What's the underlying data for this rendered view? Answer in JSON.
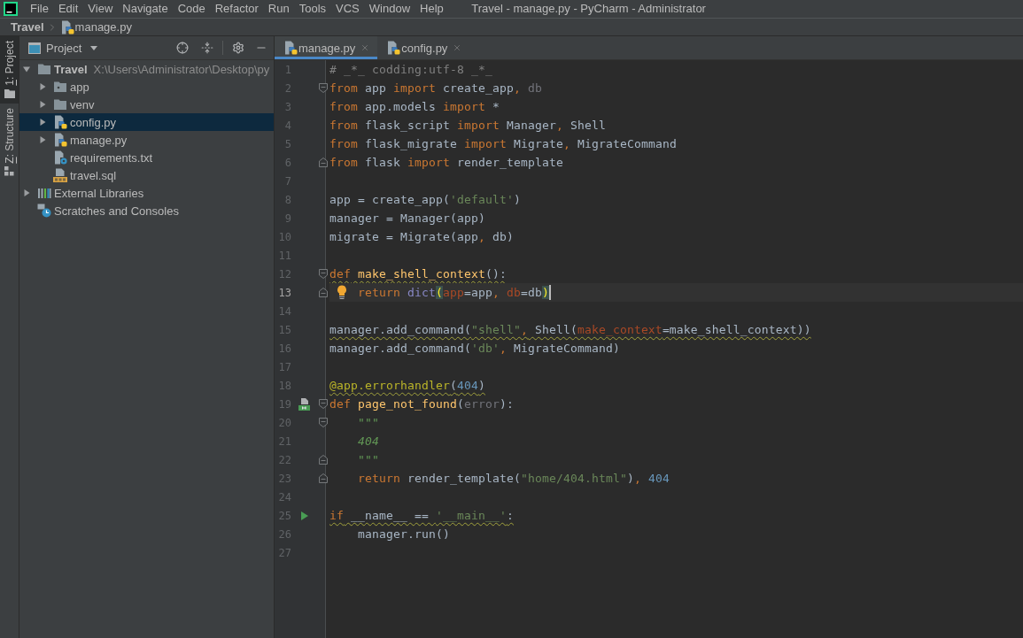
{
  "menu_bar": {
    "items": [
      "File",
      "Edit",
      "View",
      "Navigate",
      "Code",
      "Refactor",
      "Run",
      "Tools",
      "VCS",
      "Window",
      "Help"
    ],
    "title": "Travel - manage.py - PyCharm - Administrator"
  },
  "breadcrumb": [
    {
      "label": "Travel",
      "kind": "project"
    },
    {
      "label": "manage.py",
      "kind": "python"
    }
  ],
  "tool_stripe": [
    {
      "label": "1: Project",
      "kind": "project",
      "selected": true
    },
    {
      "label": "Z: Structure",
      "kind": "structure",
      "selected": false
    }
  ],
  "project_panel": {
    "title": "Project",
    "tree": [
      {
        "label": "Travel",
        "path": "X:\\Users\\Administrator\\Desktop\\py",
        "kind": "root",
        "expanded": true,
        "selected": false,
        "children": [
          {
            "label": "app",
            "kind": "package",
            "expanded": false,
            "selected": false
          },
          {
            "label": "venv",
            "kind": "folder",
            "expanded": false,
            "selected": false
          },
          {
            "label": "config.py",
            "kind": "python",
            "expanded": false,
            "selected": true
          },
          {
            "label": "manage.py",
            "kind": "python",
            "expanded": false,
            "selected": false
          },
          {
            "label": "requirements.txt",
            "kind": "requirements",
            "selected": false
          },
          {
            "label": "travel.sql",
            "kind": "sql",
            "selected": false
          }
        ]
      },
      {
        "label": "External Libraries",
        "kind": "libraries",
        "expanded": false,
        "selected": false
      },
      {
        "label": "Scratches and Consoles",
        "kind": "scratches",
        "selected": false
      }
    ]
  },
  "editor": {
    "tabs": [
      {
        "label": "manage.py",
        "selected": true
      },
      {
        "label": "config.py",
        "selected": false
      }
    ],
    "lines": [
      {
        "number": "1",
        "current": false,
        "warning": false,
        "tokens": [
          {
            "text": "# _*_ codding:utf-8 _*_",
            "kind": "comment"
          }
        ]
      },
      {
        "number": "2",
        "current": false,
        "warning": false,
        "fold_open": true,
        "tokens": [
          {
            "text": "from",
            "kind": "keyword"
          },
          {
            "text": " app ",
            "kind": "plain"
          },
          {
            "text": "import",
            "kind": "keyword"
          },
          {
            "text": " create_app",
            "kind": "plain"
          },
          {
            "text": ",",
            "kind": "comma"
          },
          {
            "text": " db",
            "kind": "unused"
          }
        ]
      },
      {
        "number": "3",
        "current": false,
        "warning": false,
        "tokens": [
          {
            "text": "from",
            "kind": "keyword"
          },
          {
            "text": " app.models ",
            "kind": "plain"
          },
          {
            "text": "import",
            "kind": "keyword"
          },
          {
            "text": " *",
            "kind": "plain"
          }
        ]
      },
      {
        "number": "4",
        "current": false,
        "warning": false,
        "tokens": [
          {
            "text": "from",
            "kind": "keyword"
          },
          {
            "text": " flask_script ",
            "kind": "plain"
          },
          {
            "text": "import",
            "kind": "keyword"
          },
          {
            "text": " Manager",
            "kind": "plain"
          },
          {
            "text": ",",
            "kind": "comma"
          },
          {
            "text": " Shell",
            "kind": "plain"
          }
        ]
      },
      {
        "number": "5",
        "current": false,
        "warning": false,
        "tokens": [
          {
            "text": "from",
            "kind": "keyword"
          },
          {
            "text": " flask_migrate ",
            "kind": "plain"
          },
          {
            "text": "import",
            "kind": "keyword"
          },
          {
            "text": " Migrate",
            "kind": "plain"
          },
          {
            "text": ",",
            "kind": "comma"
          },
          {
            "text": " MigrateCommand",
            "kind": "plain"
          }
        ]
      },
      {
        "number": "6",
        "current": false,
        "warning": false,
        "fold_close": true,
        "tokens": [
          {
            "text": "from",
            "kind": "keyword"
          },
          {
            "text": " flask ",
            "kind": "plain"
          },
          {
            "text": "import",
            "kind": "keyword"
          },
          {
            "text": " render_template",
            "kind": "plain"
          }
        ]
      },
      {
        "number": "7",
        "current": false
      },
      {
        "number": "8",
        "current": false,
        "warning": false,
        "tokens": [
          {
            "text": "app = create_app(",
            "kind": "plain"
          },
          {
            "text": "'default'",
            "kind": "string"
          },
          {
            "text": ")",
            "kind": "plain"
          }
        ]
      },
      {
        "number": "9",
        "current": false,
        "warning": false,
        "tokens": [
          {
            "text": "manager = Manager(app)",
            "kind": "plain"
          }
        ]
      },
      {
        "number": "10",
        "current": false,
        "warning": false,
        "tokens": [
          {
            "text": "migrate = Migrate(app",
            "kind": "plain"
          },
          {
            "text": ",",
            "kind": "comma"
          },
          {
            "text": " db)",
            "kind": "plain"
          }
        ]
      },
      {
        "number": "11",
        "current": false
      },
      {
        "number": "12",
        "current": false,
        "warning": true,
        "fold_open": true,
        "tokens": [
          {
            "text": "def",
            "kind": "keyword"
          },
          {
            "text": " make_shell_context",
            "kind": "funcname"
          },
          {
            "text": "():",
            "kind": "plain"
          }
        ]
      },
      {
        "number": "13",
        "current": true,
        "warning": false,
        "fold_close": true,
        "bulb": true,
        "tokens": [
          {
            "text": "    return",
            "kind": "keyword"
          },
          {
            "text": " dict",
            "kind": "builtin"
          },
          {
            "text": "(",
            "kind": "brace"
          },
          {
            "text": "app",
            "kind": "param"
          },
          {
            "text": "=app",
            "kind": "plain"
          },
          {
            "text": ",",
            "kind": "comma"
          },
          {
            "text": " db",
            "kind": "param"
          },
          {
            "text": "=db",
            "kind": "plain"
          },
          {
            "text": ")",
            "kind": "brace"
          }
        ]
      },
      {
        "number": "14",
        "current": false
      },
      {
        "number": "15",
        "current": false,
        "warning": true,
        "tokens": [
          {
            "text": "manager.add_command(",
            "kind": "plain"
          },
          {
            "text": "\"shell\"",
            "kind": "string"
          },
          {
            "text": ",",
            "kind": "comma"
          },
          {
            "text": " Shell(",
            "kind": "plain"
          },
          {
            "text": "make_context",
            "kind": "param"
          },
          {
            "text": "=make_shell_context))",
            "kind": "plain"
          }
        ]
      },
      {
        "number": "16",
        "current": false,
        "warning": false,
        "tokens": [
          {
            "text": "manager.add_command(",
            "kind": "plain"
          },
          {
            "text": "'db'",
            "kind": "string"
          },
          {
            "text": ",",
            "kind": "comma"
          },
          {
            "text": " MigrateCommand)",
            "kind": "plain"
          }
        ]
      },
      {
        "number": "17",
        "current": false
      },
      {
        "number": "18",
        "current": false,
        "warning": true,
        "tokens": [
          {
            "text": "@app.errorhandler",
            "kind": "decorator"
          },
          {
            "text": "(",
            "kind": "plain"
          },
          {
            "text": "404",
            "kind": "number"
          },
          {
            "text": ")",
            "kind": "plain"
          }
        ]
      },
      {
        "number": "19",
        "current": false,
        "warning": false,
        "fold_open": true,
        "template_icon": true,
        "tokens": [
          {
            "text": "def",
            "kind": "keyword"
          },
          {
            "text": " page_not_found",
            "kind": "funcname"
          },
          {
            "text": "(",
            "kind": "plain"
          },
          {
            "text": "error",
            "kind": "unused"
          },
          {
            "text": "):",
            "kind": "plain"
          }
        ]
      },
      {
        "number": "20",
        "current": false,
        "warning": false,
        "fold_open": true,
        "tokens": [
          {
            "text": "    \"\"\"",
            "kind": "docstring"
          }
        ]
      },
      {
        "number": "21",
        "current": false,
        "warning": false,
        "tokens": [
          {
            "text": "    404",
            "kind": "docstring"
          }
        ]
      },
      {
        "number": "22",
        "current": false,
        "warning": false,
        "fold_close": true,
        "tokens": [
          {
            "text": "    \"\"\"",
            "kind": "docstring"
          }
        ]
      },
      {
        "number": "23",
        "current": false,
        "warning": false,
        "fold_close": true,
        "tokens": [
          {
            "text": "    return",
            "kind": "keyword"
          },
          {
            "text": " render_template(",
            "kind": "plain"
          },
          {
            "text": "\"home/404.html\"",
            "kind": "string"
          },
          {
            "text": ")",
            "kind": "plain"
          },
          {
            "text": ",",
            "kind": "comma"
          },
          {
            "text": " 404",
            "kind": "number"
          }
        ]
      },
      {
        "number": "24",
        "current": false
      },
      {
        "number": "25",
        "current": false,
        "warning": true,
        "run_icon": true,
        "tokens": [
          {
            "text": "if",
            "kind": "keyword"
          },
          {
            "text": " __name__ == ",
            "kind": "plain"
          },
          {
            "text": "'__main__'",
            "kind": "string"
          },
          {
            "text": ":",
            "kind": "plain"
          }
        ]
      },
      {
        "number": "26",
        "current": false,
        "warning": false,
        "tokens": [
          {
            "text": "    manager.run()",
            "kind": "plain"
          }
        ]
      },
      {
        "number": "27",
        "current": false
      }
    ]
  }
}
